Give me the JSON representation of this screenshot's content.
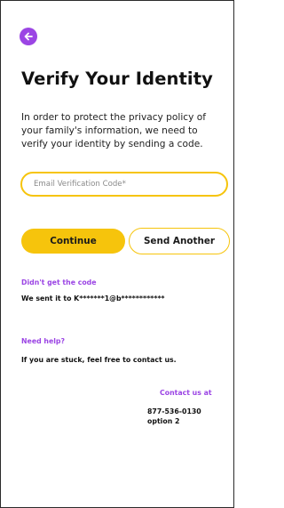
{
  "header": {
    "back_icon": "arrow-left-circle-icon",
    "title": "Verify Your Identity"
  },
  "intro": {
    "text": "In order to protect the privacy policy of your family's information, we need to verify your identity by sending a code."
  },
  "form": {
    "code_placeholder": "Email Verification Code*",
    "code_value": ""
  },
  "actions": {
    "continue_label": "Continue",
    "send_another_label": "Send Another"
  },
  "resend_info": {
    "label": "Didn't get the code",
    "sent_to": "We sent it to K*******1@b************"
  },
  "help": {
    "label": "Need help?",
    "text": "If you are stuck, feel free to contact us."
  },
  "contact": {
    "label": "Contact us at",
    "phone": "877-536-0130",
    "option": "option 2"
  },
  "colors": {
    "accent_purple": "#9b45e4",
    "accent_yellow": "#f6c40c"
  }
}
